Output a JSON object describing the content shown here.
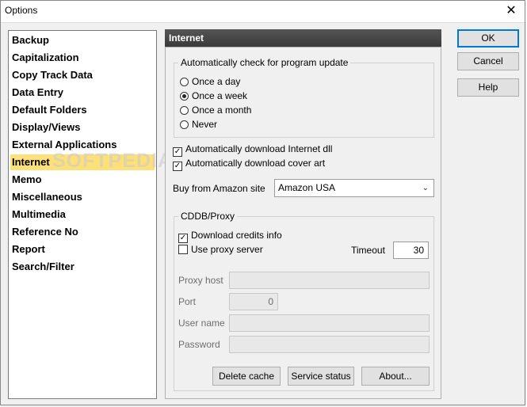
{
  "window": {
    "title": "Options",
    "close_glyph": "✕"
  },
  "categories": [
    {
      "label": "Backup",
      "selected": false
    },
    {
      "label": "Capitalization",
      "selected": false
    },
    {
      "label": "Copy Track Data",
      "selected": false
    },
    {
      "label": "Data Entry",
      "selected": false
    },
    {
      "label": "Default Folders",
      "selected": false
    },
    {
      "label": "Display/Views",
      "selected": false
    },
    {
      "label": "External Applications",
      "selected": false
    },
    {
      "label": "Internet",
      "selected": true
    },
    {
      "label": "Memo",
      "selected": false
    },
    {
      "label": "Miscellaneous",
      "selected": false
    },
    {
      "label": "Multimedia",
      "selected": false
    },
    {
      "label": "Reference No",
      "selected": false
    },
    {
      "label": "Report",
      "selected": false
    },
    {
      "label": "Search/Filter",
      "selected": false
    }
  ],
  "watermark": "SOFTPEDIA",
  "panel": {
    "header": "Internet",
    "update_group": {
      "title": "Automatically check for program update",
      "options": [
        {
          "label": "Once a day",
          "selected": false
        },
        {
          "label": "Once a week",
          "selected": true
        },
        {
          "label": "Once a month",
          "selected": false
        },
        {
          "label": "Never",
          "selected": false
        }
      ]
    },
    "download_internet_dll": {
      "label": "Automatically download Internet dll",
      "checked": true
    },
    "download_cover_art": {
      "label": "Automatically download cover art",
      "checked": true
    },
    "amazon": {
      "label": "Buy from Amazon site",
      "value": "Amazon USA"
    },
    "cddb": {
      "title": "CDDB/Proxy",
      "download_credits": {
        "label": "Download credits info",
        "checked": true
      },
      "use_proxy": {
        "label": "Use proxy server",
        "checked": false
      },
      "timeout_label": "Timeout",
      "timeout_value": "30",
      "proxy_host_label": "Proxy host",
      "proxy_host_value": "",
      "port_label": "Port",
      "port_value": "0",
      "user_name_label": "User name",
      "user_name_value": "",
      "password_label": "Password",
      "password_value": "",
      "delete_cache": "Delete cache",
      "service_status": "Service status",
      "about": "About..."
    }
  },
  "buttons": {
    "ok": "OK",
    "cancel": "Cancel",
    "help": "Help"
  },
  "colors": {
    "selection": "#fde07a",
    "header_bg": "#444444",
    "default_button_border": "#0078d7"
  },
  "icons": {
    "check": "✓",
    "dropdown": "chevron-down-icon"
  }
}
